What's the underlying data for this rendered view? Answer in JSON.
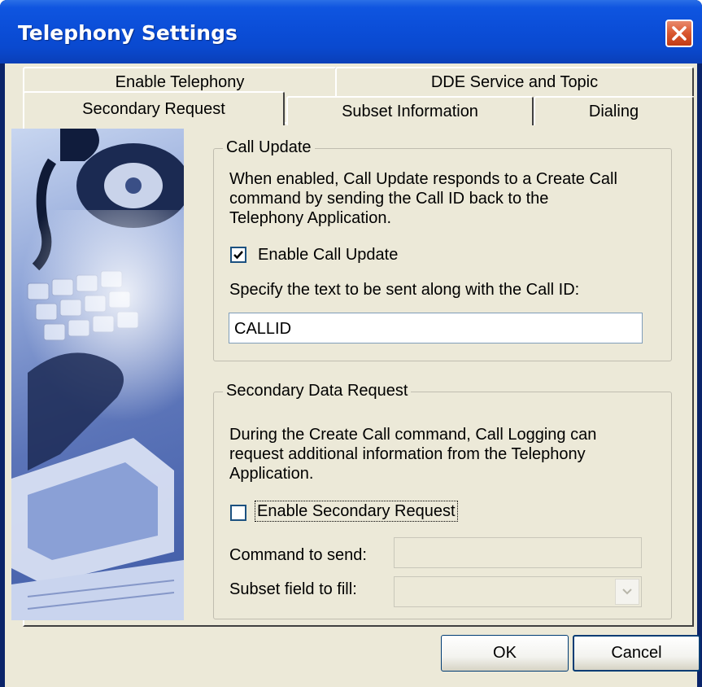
{
  "window": {
    "title": "Telephony Settings"
  },
  "tabs": {
    "row_back": [
      "Enable Telephony",
      "DDE Service and Topic"
    ],
    "row_front": [
      "Secondary Request",
      "Subset Information",
      "Dialing"
    ],
    "active": "Secondary Request"
  },
  "call_update": {
    "group_label": "Call Update",
    "description_lines": [
      "When enabled, Call Update responds to a Create Call",
      "command by sending the Call ID back to the",
      "Telephony Application."
    ],
    "checkbox_label": "Enable Call Update",
    "checkbox_checked": true,
    "text_prompt": "Specify the text to be sent along with the Call ID:",
    "text_value": "CALLID"
  },
  "secondary_request": {
    "group_label": "Secondary Data Request",
    "description_lines": [
      "During the Create Call command, Call Logging can",
      "request additional information from the Telephony",
      "Application."
    ],
    "checkbox_label": "Enable Secondary Request",
    "checkbox_checked": false,
    "command_label": "Command to send:",
    "command_value": "",
    "subset_label": "Subset field to fill:",
    "subset_value": ""
  },
  "buttons": {
    "ok": "OK",
    "cancel": "Cancel"
  },
  "icons": {
    "close": "close-icon",
    "check": "checkmark-icon",
    "dropdown": "chevron-down-icon"
  },
  "colors": {
    "titlebar": "#0b4ed8",
    "dialog_bg": "#ece9d8",
    "close_button": "#d9572f"
  }
}
